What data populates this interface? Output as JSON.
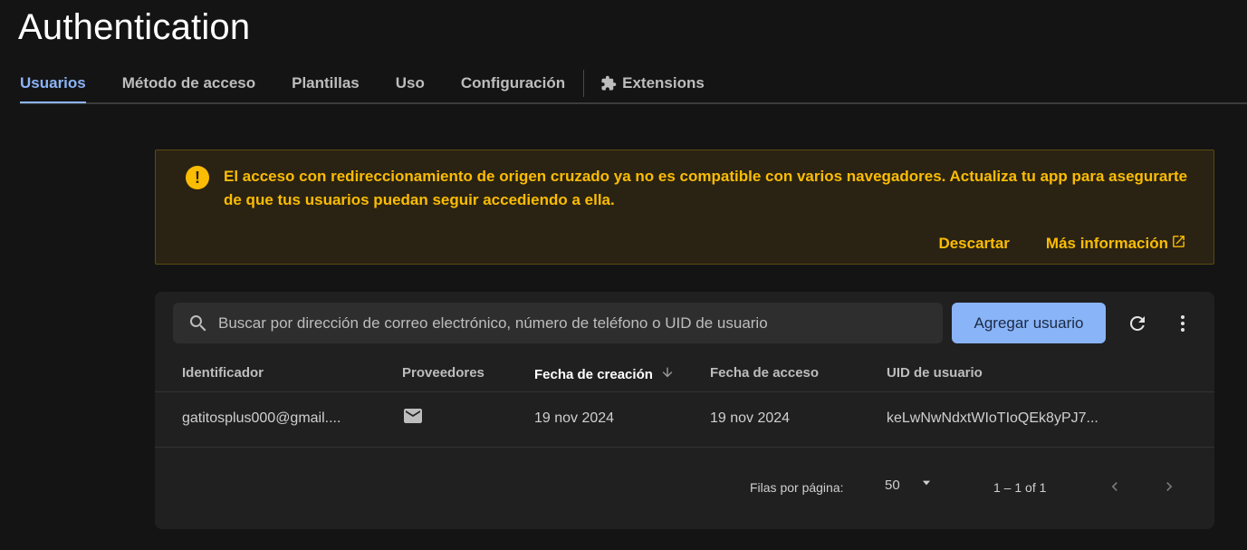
{
  "page": {
    "title": "Authentication"
  },
  "tabs": [
    {
      "label": "Usuarios",
      "active": true
    },
    {
      "label": "Método de acceso"
    },
    {
      "label": "Plantillas"
    },
    {
      "label": "Uso"
    },
    {
      "label": "Configuración"
    },
    {
      "label": "Extensions",
      "icon": "puzzle-icon"
    }
  ],
  "banner": {
    "icon": "warning-icon",
    "text": "El acceso con redireccionamiento de origen cruzado ya no es compatible con varios navegadores. Actualiza tu app para asegurarte de que tus usuarios puedan seguir accediendo a ella.",
    "dismiss_label": "Descartar",
    "more_label": "Más información",
    "color": "#fbbc04"
  },
  "toolbar": {
    "search_placeholder": "Buscar por dirección de correo electrónico, número de teléfono o UID de usuario",
    "add_label": "Agregar usuario"
  },
  "table": {
    "columns": [
      "Identificador",
      "Proveedores",
      "Fecha de creación",
      "Fecha de acceso",
      "UID de usuario"
    ],
    "sorted_column": "Fecha de creación",
    "rows": [
      {
        "identifier": "gatitosplus000@gmail....",
        "provider_icon": "email-icon",
        "created": "19 nov 2024",
        "signed_in": "19 nov 2024",
        "uid": "keLwNwNdxtWIoTIoQEk8yPJ7..."
      }
    ]
  },
  "pagination": {
    "rows_label": "Filas por página:",
    "rows_value": "50",
    "range": "1 – 1 of 1"
  },
  "colors": {
    "accent": "#8ab4f8",
    "warning": "#fbbc04",
    "background": "#141414"
  }
}
